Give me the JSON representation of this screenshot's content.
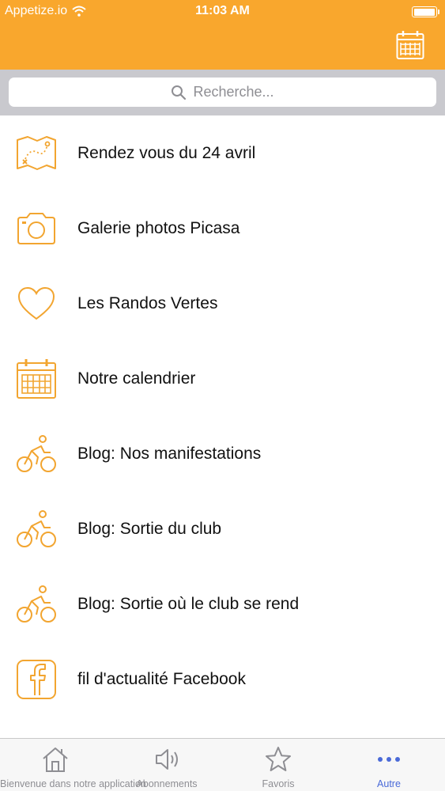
{
  "status_bar": {
    "carrier": "Appetize.io",
    "time": "11:03 AM",
    "battery_level": 1.0
  },
  "nav_bar": {
    "right_icon": "calendar-icon"
  },
  "search": {
    "placeholder": "Recherche..."
  },
  "list": {
    "items": [
      {
        "label": "Rendez vous du 24 avril",
        "icon": "map-icon"
      },
      {
        "label": "Galerie photos Picasa",
        "icon": "camera-icon"
      },
      {
        "label": "Les Randos Vertes",
        "icon": "heart-icon"
      },
      {
        "label": "Notre calendrier",
        "icon": "calendar-icon"
      },
      {
        "label": "Blog: Nos manifestations",
        "icon": "cyclist-icon"
      },
      {
        "label": "Blog: Sortie du club",
        "icon": "cyclist-icon"
      },
      {
        "label": "Blog: Sortie où le club se rend",
        "icon": "cyclist-icon"
      },
      {
        "label": "fil d'actualité Facebook",
        "icon": "facebook-icon"
      }
    ]
  },
  "tab_bar": {
    "tabs": [
      {
        "label": "Bienvenue dans notre application",
        "icon": "home-icon",
        "active": false
      },
      {
        "label": "Abonnements",
        "icon": "speaker-icon",
        "active": false
      },
      {
        "label": "Favoris",
        "icon": "star-icon",
        "active": false
      },
      {
        "label": "Autre",
        "icon": "more-icon",
        "active": true
      }
    ]
  },
  "colors": {
    "accent": "#f9a72d",
    "icon": "#f2a530",
    "tab_active": "#4a6ad8",
    "tab_inactive": "#8e8e93"
  }
}
